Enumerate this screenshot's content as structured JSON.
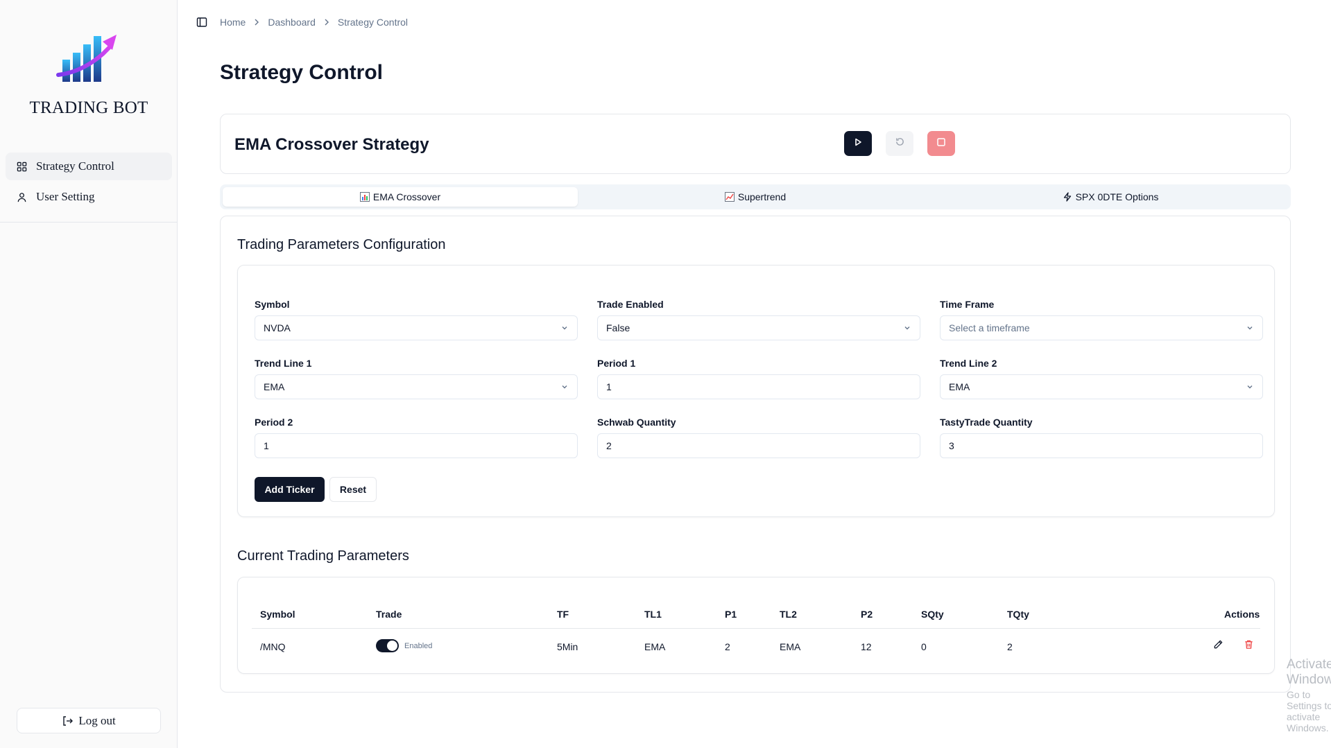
{
  "sidebar": {
    "brand": "TRADING BOT",
    "items": [
      {
        "label": "Strategy Control",
        "icon": "grid-icon"
      },
      {
        "label": "User Setting",
        "icon": "user-icon"
      }
    ],
    "logout_label": "Log out"
  },
  "breadcrumb": [
    "Home",
    "Dashboard",
    "Strategy Control"
  ],
  "page_title": "Strategy Control",
  "strategy": {
    "title": "EMA Crossover Strategy"
  },
  "tabs": [
    {
      "label": "EMA Crossover",
      "icon": "bar-chart-icon",
      "active": true
    },
    {
      "label": "Supertrend",
      "icon": "line-chart-icon",
      "active": false
    },
    {
      "label": "SPX 0DTE Options",
      "icon": "lightning-icon",
      "active": false
    }
  ],
  "config": {
    "title": "Trading Parameters Configuration",
    "fields": {
      "symbol": {
        "label": "Symbol",
        "value": "NVDA"
      },
      "trade_enabled": {
        "label": "Trade Enabled",
        "value": "False"
      },
      "time_frame": {
        "label": "Time Frame",
        "placeholder": "Select a timeframe"
      },
      "trend_line_1": {
        "label": "Trend Line 1",
        "value": "EMA"
      },
      "period_1": {
        "label": "Period 1",
        "value": "1"
      },
      "trend_line_2": {
        "label": "Trend Line 2",
        "value": "EMA"
      },
      "period_2": {
        "label": "Period 2",
        "value": "1"
      },
      "schwab_qty": {
        "label": "Schwab Quantity",
        "value": "2"
      },
      "tasty_qty": {
        "label": "TastyTrade Quantity",
        "value": "3"
      }
    },
    "add_label": "Add Ticker",
    "reset_label": "Reset"
  },
  "table": {
    "title": "Current Trading Parameters",
    "headers": [
      "Symbol",
      "Trade",
      "TF",
      "TL1",
      "P1",
      "TL2",
      "P2",
      "SQty",
      "TQty",
      "Actions"
    ],
    "rows": [
      {
        "symbol": "/MNQ",
        "trade": "Enabled",
        "tf": "5Min",
        "tl1": "EMA",
        "p1": "2",
        "tl2": "EMA",
        "p2": "12",
        "sqty": "0",
        "tqty": "2"
      }
    ]
  },
  "watermark": {
    "line1": "Activate Windows",
    "line2": "Go to Settings to activate Windows."
  },
  "colors": {
    "primary": "#0f172a",
    "stop": "#f28b8f",
    "delete": "#ef4444"
  }
}
